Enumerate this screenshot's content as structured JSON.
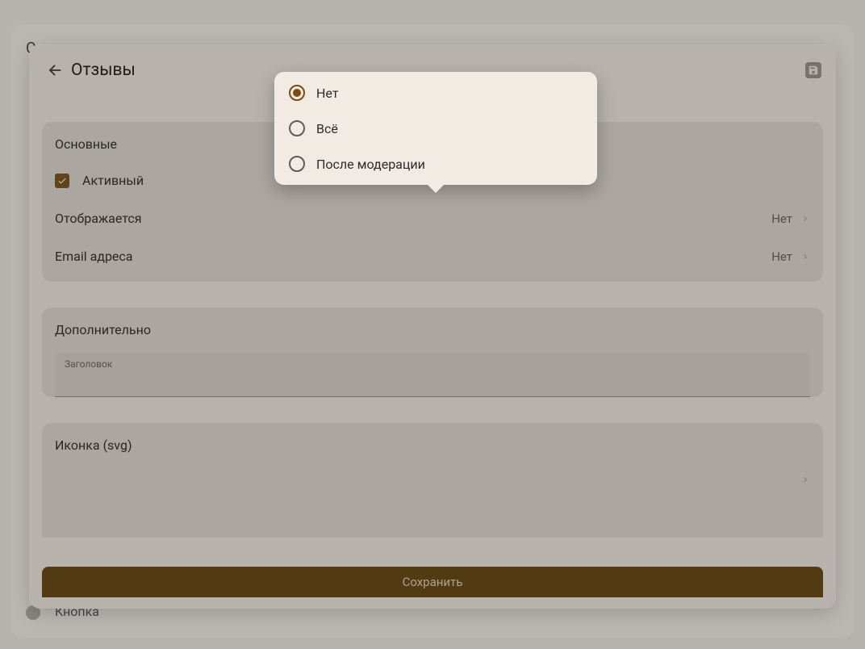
{
  "background": {
    "title": "Системные",
    "item": "Кнопка"
  },
  "sheet": {
    "title": "Отзывы"
  },
  "sections": {
    "main_header": "Основные",
    "active_label": "Активный",
    "displayed_label": "Отображается",
    "displayed_value": "Нет",
    "emails_label": "Email адреса",
    "emails_value": "Нет",
    "extra_header": "Дополнительно",
    "title_field_label": "Заголовок",
    "icon_header": "Иконка (svg)"
  },
  "save_button": "Сохранить",
  "popover": {
    "options": [
      {
        "label": "Нет",
        "selected": true
      },
      {
        "label": "Всё",
        "selected": false
      },
      {
        "label": "После модерации",
        "selected": false
      }
    ]
  }
}
